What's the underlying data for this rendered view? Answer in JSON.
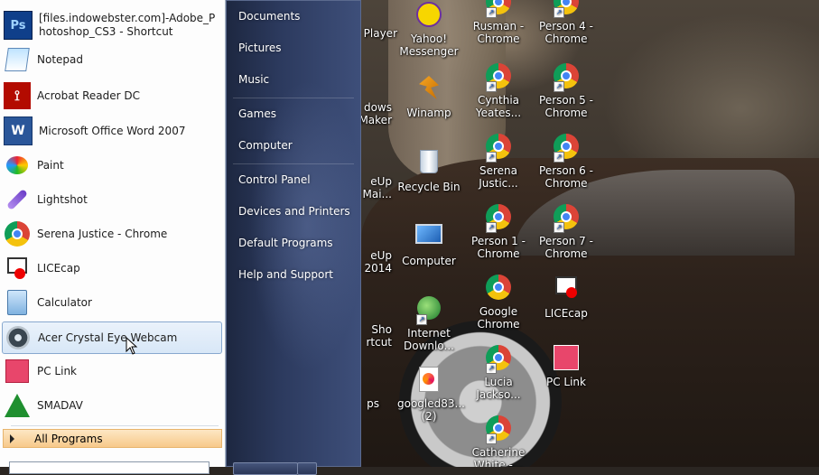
{
  "start_menu": {
    "programs": [
      {
        "label_line1": "[files.indowebster.com]-Adobe_P",
        "label_line2": "hotoshop_CS3 - Shortcut",
        "icon": "photoshop-icon",
        "color": "#0f3f8a"
      },
      {
        "label": "Notepad",
        "icon": "notepad-icon"
      },
      {
        "label": "Acrobat Reader DC",
        "icon": "acrobat-icon",
        "color": "#b30b00"
      },
      {
        "label": "Microsoft Office Word 2007",
        "icon": "word-icon",
        "color": "#2a5699"
      },
      {
        "label": "Paint",
        "icon": "paint-icon"
      },
      {
        "label": "Lightshot",
        "icon": "lightshot-icon",
        "color": "#7a4fd1"
      },
      {
        "label": "Serena Justice - Chrome",
        "icon": "chrome-icon"
      },
      {
        "label": "LICEcap",
        "icon": "licecap-icon"
      },
      {
        "label": "Calculator",
        "icon": "calculator-icon"
      },
      {
        "label": "Acer Crystal Eye Webcam",
        "icon": "webcam-icon",
        "selected": true
      },
      {
        "label": "PC Link",
        "icon": "pclink-icon",
        "color": "#e8466b"
      },
      {
        "label": "SMADAV",
        "icon": "smadav-icon",
        "color": "#1f8f2f"
      }
    ],
    "all_programs": "All Programs",
    "right_items": [
      "Documents",
      "Pictures",
      "Music",
      "Games",
      "Computer",
      "Control Panel",
      "Devices and Printers",
      "Default Programs",
      "Help and Support"
    ]
  },
  "desktop": {
    "partial_left": [
      "Player",
      "dows\nMaker",
      "eUp\nt Mai...",
      "eUp\ns 2014",
      "Sho\nrtcut",
      "ps"
    ],
    "icons": [
      {
        "label": "Yahoo!\nMessenger",
        "icon": "yahoo-icon"
      },
      {
        "label": "Winamp",
        "icon": "winamp-icon"
      },
      {
        "label": "Recycle Bin",
        "icon": "recycle-bin-icon"
      },
      {
        "label": "Computer",
        "icon": "computer-icon"
      },
      {
        "label": "Internet\nDownlo...",
        "icon": "idm-icon"
      },
      {
        "label": "googled83...\n(2)",
        "icon": "file-icon"
      },
      {
        "label": "Rusman -\nChrome",
        "icon": "chrome-icon"
      },
      {
        "label": "Cynthia\nYeates...",
        "icon": "chrome-icon"
      },
      {
        "label": "Serena\nJustic...",
        "icon": "chrome-icon"
      },
      {
        "label": "Person 1 -\nChrome",
        "icon": "chrome-icon"
      },
      {
        "label": "Google\nChrome",
        "icon": "chrome-icon"
      },
      {
        "label": "Lucia\nJackso...",
        "icon": "chrome-icon"
      },
      {
        "label": "Catherine\nWhite -...",
        "icon": "chrome-icon"
      },
      {
        "label": "Person 4 -\nChrome",
        "icon": "chrome-icon"
      },
      {
        "label": "Person 5 -\nChrome",
        "icon": "chrome-icon"
      },
      {
        "label": "Person 6 -\nChrome",
        "icon": "chrome-icon"
      },
      {
        "label": "Person 7 -\nChrome",
        "icon": "chrome-icon"
      },
      {
        "label": "LICEcap",
        "icon": "licecap-icon"
      },
      {
        "label": "PC Link",
        "icon": "pclink-icon"
      }
    ]
  }
}
